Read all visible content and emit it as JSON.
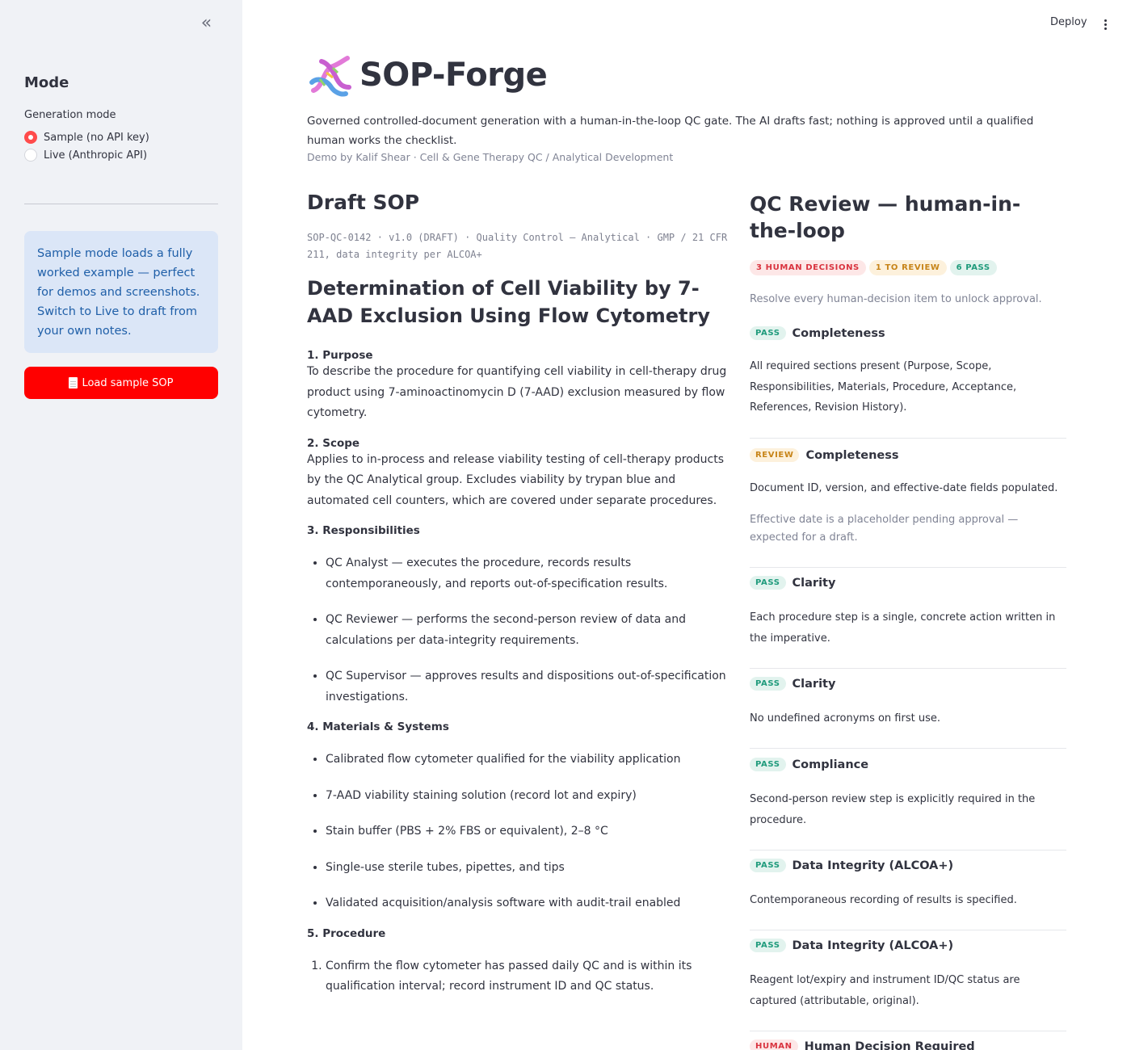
{
  "sidebar": {
    "collapse_icon": "chevrons-left-icon",
    "title": "Mode",
    "mode_label": "Generation mode",
    "options": [
      "Sample (no API key)",
      "Live (Anthropic API)"
    ],
    "selected_option": "Sample (no API key)",
    "info": "Sample mode loads a fully worked example — perfect for demos and screenshots. Switch to Live to draft from your own notes.",
    "load_button": "Load sample SOP",
    "load_button_icon": "document-icon"
  },
  "toolbar": {
    "deploy": "Deploy",
    "menu_icon": "kebab-menu-icon"
  },
  "header": {
    "logo_icon": "dna-icon",
    "title": "SOP-Forge",
    "subtitle": "Governed controlled-document generation with a human-in-the-loop QC gate. The AI drafts fast; nothing is approved until a qualified human works the checklist.",
    "byline": "Demo by Kalif Shear · Cell & Gene Therapy QC / Analytical Development"
  },
  "draft": {
    "heading": "Draft SOP",
    "meta": "SOP-QC-0142 · v1.0 (DRAFT) · Quality Control — Analytical · GMP / 21 CFR 211, data integrity per ALCOA+",
    "title": "Determination of Cell Viability by 7-AAD Exclusion Using Flow Cytometry",
    "purpose": {
      "heading": "1. Purpose",
      "text": "To describe the procedure for quantifying cell viability in cell-therapy drug product using 7-aminoactinomycin D (7-AAD) exclusion measured by flow cytometry."
    },
    "scope": {
      "heading": "2. Scope",
      "text": "Applies to in-process and release viability testing of cell-therapy products by the QC Analytical group. Excludes viability by trypan blue and automated cell counters, which are covered under separate procedures."
    },
    "responsibilities": {
      "heading": "3. Responsibilities",
      "items": [
        "QC Analyst — executes the procedure, records results contemporaneously, and reports out-of-specification results.",
        "QC Reviewer — performs the second-person review of data and calculations per data-integrity requirements.",
        "QC Supervisor — approves results and dispositions out-of-specification investigations."
      ]
    },
    "materials": {
      "heading": "4. Materials & Systems",
      "items": [
        "Calibrated flow cytometer qualified for the viability application",
        "7-AAD viability staining solution (record lot and expiry)",
        "Stain buffer (PBS + 2% FBS or equivalent), 2–8 °C",
        "Single-use sterile tubes, pipettes, and tips",
        "Validated acquisition/analysis software with audit-trail enabled"
      ]
    },
    "procedure": {
      "heading": "5. Procedure",
      "items": [
        "Confirm the flow cytometer has passed daily QC and is within its qualification interval; record instrument ID and QC status."
      ]
    }
  },
  "qc": {
    "heading": "QC Review — human-in-the-loop",
    "summary": {
      "human": "3 HUMAN DECISIONS",
      "review": "1 TO REVIEW",
      "pass": "6 PASS"
    },
    "resolve_note": "Resolve every human-decision item to unlock approval.",
    "checks": [
      {
        "status": "PASS",
        "category": "Completeness",
        "text": "All required sections present (Purpose, Scope, Responsibilities, Materials, Procedure, Acceptance, References, Revision History)."
      },
      {
        "status": "REVIEW",
        "category": "Completeness",
        "text": "Document ID, version, and effective-date fields populated.",
        "note": "Effective date is a placeholder pending approval — expected for a draft."
      },
      {
        "status": "PASS",
        "category": "Clarity",
        "text": "Each procedure step is a single, concrete action written in the imperative."
      },
      {
        "status": "PASS",
        "category": "Clarity",
        "text": "No undefined acronyms on first use."
      },
      {
        "status": "PASS",
        "category": "Compliance",
        "text": "Second-person review step is explicitly required in the procedure."
      },
      {
        "status": "PASS",
        "category": "Data Integrity (ALCOA+)",
        "text": "Contemporaneous recording of results is specified."
      },
      {
        "status": "PASS",
        "category": "Data Integrity (ALCOA+)",
        "text": "Reagent lot/expiry and instrument ID/QC status are captured (attributable, original)."
      },
      {
        "status": "HUMAN",
        "category": "Human Decision Required"
      }
    ]
  }
}
